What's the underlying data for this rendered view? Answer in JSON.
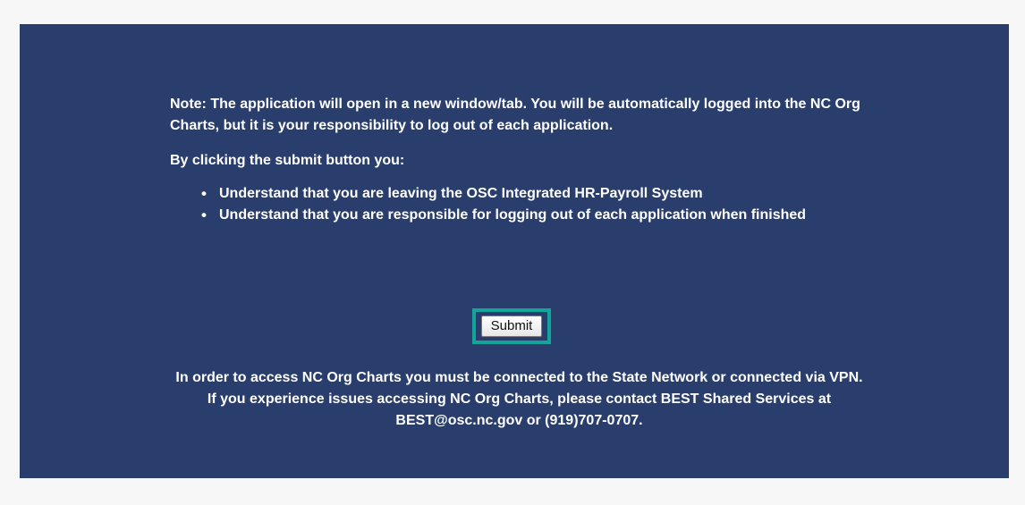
{
  "notice": {
    "note_text": "Note: The application will open in a new window/tab. You will be automatically logged into the NC Org Charts, but it is your responsibility to log out of each application.",
    "intro_text": "By clicking the submit button you:",
    "bullets": [
      "Understand that you are leaving the OSC Integrated HR-Payroll System",
      "Understand that you are responsible for logging out of each application when finished"
    ]
  },
  "actions": {
    "submit_label": "Submit"
  },
  "footer": {
    "network_notice": "In order to access NC Org Charts you must be connected to the State Network or connected via VPN.",
    "support_notice": "If you experience issues accessing NC Org Charts, please contact BEST Shared Services at BEST@osc.nc.gov or (919)707-0707."
  },
  "colors": {
    "panel_background": "#2a3e6d",
    "highlight_border": "#14a59a"
  }
}
